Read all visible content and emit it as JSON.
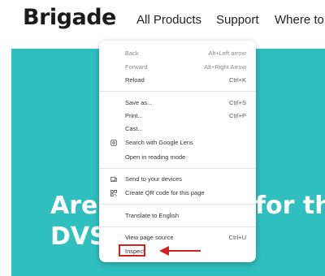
{
  "header": {
    "logo": "Brigade",
    "nav": [
      "All Products",
      "Support",
      "Where to I"
    ]
  },
  "hero": {
    "line1_left": "Are",
    "line1_right": "for th",
    "line2": "DVS"
  },
  "context_menu": {
    "items": [
      {
        "label": "Back",
        "shortcut": "Alt+Left arrow"
      },
      {
        "label": "Forward",
        "shortcut": "Alt+Right Arrow"
      },
      {
        "label": "Reload",
        "shortcut": "Ctrl+K"
      },
      {
        "label": "Save as...",
        "shortcut": "Ctrl+S"
      },
      {
        "label": "Print...",
        "shortcut": "Ctrl+P"
      },
      {
        "label": "Cast..."
      },
      {
        "label": "Search with Google Lens",
        "icon": "lens-icon"
      },
      {
        "label": "Open in reading mode"
      },
      {
        "label": "Send to your devices",
        "icon": "devices-icon"
      },
      {
        "label": "Create QR code for this page",
        "icon": "qr-code-icon"
      },
      {
        "label": "Translate to English"
      },
      {
        "label": "View page source",
        "shortcut": "Ctrl+U"
      },
      {
        "label": "Inspect",
        "highlighted": true
      }
    ]
  },
  "annotation": {
    "highlight_color": "#d32020",
    "arrow": "left-arrow-icon"
  },
  "colors": {
    "hero_background": "#2fbfbf",
    "logo": "#1b1b1b"
  }
}
